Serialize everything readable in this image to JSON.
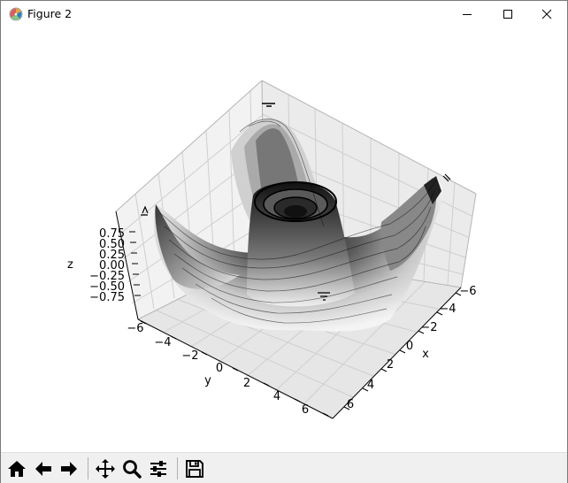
{
  "window": {
    "title": "Figure 2"
  },
  "plot": {
    "type": "3d-contour",
    "colormap": "binary",
    "grid": true,
    "z_axis": {
      "label": "z",
      "ticks": [
        "0.75",
        "0.50",
        "0.25",
        "0.00",
        "−0.25",
        "−0.50",
        "−0.75"
      ]
    },
    "y_axis": {
      "label": "y",
      "ticks": [
        "−6",
        "−4",
        "−2",
        "0",
        "2",
        "4",
        "6"
      ]
    },
    "x_axis": {
      "label": "x",
      "ticks": [
        "−6",
        "−4",
        "−2",
        "0",
        "2",
        "4",
        "6"
      ]
    }
  },
  "toolbar": {
    "buttons": [
      "home-icon",
      "back-icon",
      "forward-icon",
      "pan-icon",
      "zoom-icon",
      "configure-subplots-icon",
      "save-icon"
    ]
  }
}
